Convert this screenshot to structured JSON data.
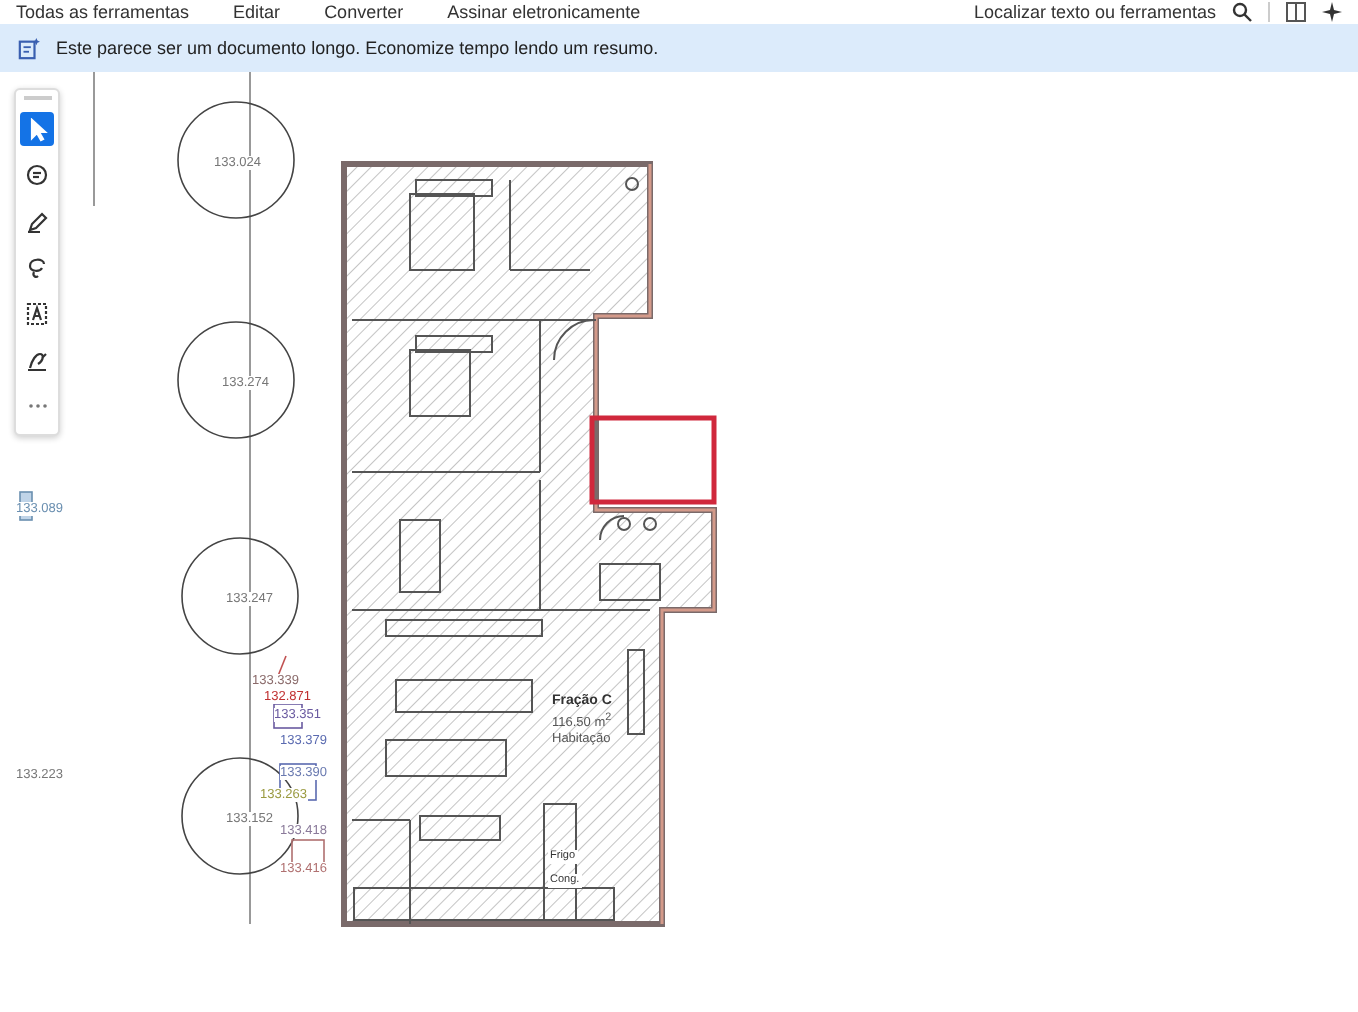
{
  "menu": [
    "Todas as ferramentas",
    "Editar",
    "Converter",
    "Assinar eletronicamente"
  ],
  "search": {
    "placeholder": "Localizar texto ou ferramentas"
  },
  "banner": {
    "text": "Este parece ser um documento longo. Economize tempo lendo um resumo."
  },
  "tools": [
    {
      "kind": "select",
      "selected": true
    },
    {
      "kind": "comment",
      "selected": false
    },
    {
      "kind": "pen",
      "selected": false
    },
    {
      "kind": "lasso",
      "selected": false
    },
    {
      "kind": "textbox",
      "selected": false
    },
    {
      "kind": "sign",
      "selected": false
    },
    {
      "kind": "more",
      "selected": false
    }
  ],
  "plan": {
    "survey_points": [
      {
        "text": "133.024",
        "color": "#777777"
      },
      {
        "text": "133.274",
        "color": "#777777"
      },
      {
        "text": "133.247",
        "color": "#777777"
      },
      {
        "text": "133.152",
        "color": "#777777"
      },
      {
        "text": "133.089",
        "color": "#6a8fb0"
      },
      {
        "text": "133.223",
        "color": "#777777"
      },
      {
        "text": "133.339",
        "color": "#8a6a6a"
      },
      {
        "text": "132.871",
        "color": "#c03030"
      },
      {
        "text": "133.351",
        "color": "#6a5aa0"
      },
      {
        "text": "133.379",
        "color": "#5a6ab0"
      },
      {
        "text": "133.390",
        "color": "#6a7ab0"
      },
      {
        "text": "133.263",
        "color": "#9a9a40"
      },
      {
        "text": "133.418",
        "color": "#8a7a9a"
      },
      {
        "text": "133.416",
        "color": "#b07070"
      }
    ],
    "unit": {
      "name": "Fração C",
      "area": "116.50 m$^{2}$",
      "use": "Habitação"
    },
    "fixtures": [
      "Frigo",
      "Cong."
    ]
  }
}
